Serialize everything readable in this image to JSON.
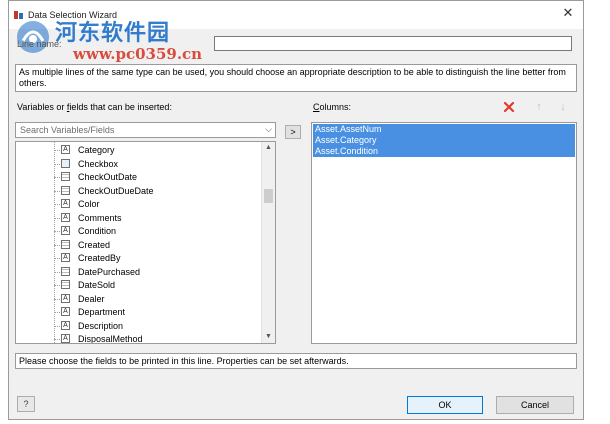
{
  "window": {
    "title": "Data Selection Wizard",
    "close_glyph": "✕"
  },
  "watermark": {
    "site_name": "河东软件园",
    "url": "www.pc0359.cn"
  },
  "line_name": {
    "label": "Line name:",
    "value": ""
  },
  "description": "As multiple lines of the same type can be used, you should choose an appropriate description to be able to distinguish the line better from others.",
  "variables": {
    "label_prefix": "Variables or ",
    "label_underlined": "f",
    "label_suffix": "ields that can be inserted:",
    "search_placeholder": "Search Variables/Fields",
    "items": [
      {
        "label": "Category",
        "icon": "text-field-icon"
      },
      {
        "label": "Checkbox",
        "icon": "image-field-icon"
      },
      {
        "label": "CheckOutDate",
        "icon": "date-field-icon"
      },
      {
        "label": "CheckOutDueDate",
        "icon": "date-field-icon"
      },
      {
        "label": "Color",
        "icon": "text-field-icon"
      },
      {
        "label": "Comments",
        "icon": "text-field-icon"
      },
      {
        "label": "Condition",
        "icon": "text-field-icon"
      },
      {
        "label": "Created",
        "icon": "date-field-icon"
      },
      {
        "label": "CreatedBy",
        "icon": "text-field-icon"
      },
      {
        "label": "DatePurchased",
        "icon": "date-field-icon"
      },
      {
        "label": "DateSold",
        "icon": "date-field-icon"
      },
      {
        "label": "Dealer",
        "icon": "text-field-icon"
      },
      {
        "label": "Department",
        "icon": "text-field-icon"
      },
      {
        "label": "Description",
        "icon": "text-field-icon"
      },
      {
        "label": "DisposalMethod",
        "icon": "text-field-icon"
      }
    ]
  },
  "columns": {
    "label_underlined": "C",
    "label_suffix": "olumns:",
    "items": [
      "Asset.AssetNum",
      "Asset.Category",
      "Asset.Condition"
    ]
  },
  "add_button": ">",
  "hint": "Please choose the fields to be printed in this line. Properties can be set afterwards.",
  "buttons": {
    "help": "?",
    "ok": "OK",
    "cancel": "Cancel"
  },
  "colors": {
    "selection": "#4a90e2",
    "delete_icon": "#e03a2f",
    "watermark_blue": "#1d6fc6",
    "watermark_red": "#d63a2b"
  }
}
